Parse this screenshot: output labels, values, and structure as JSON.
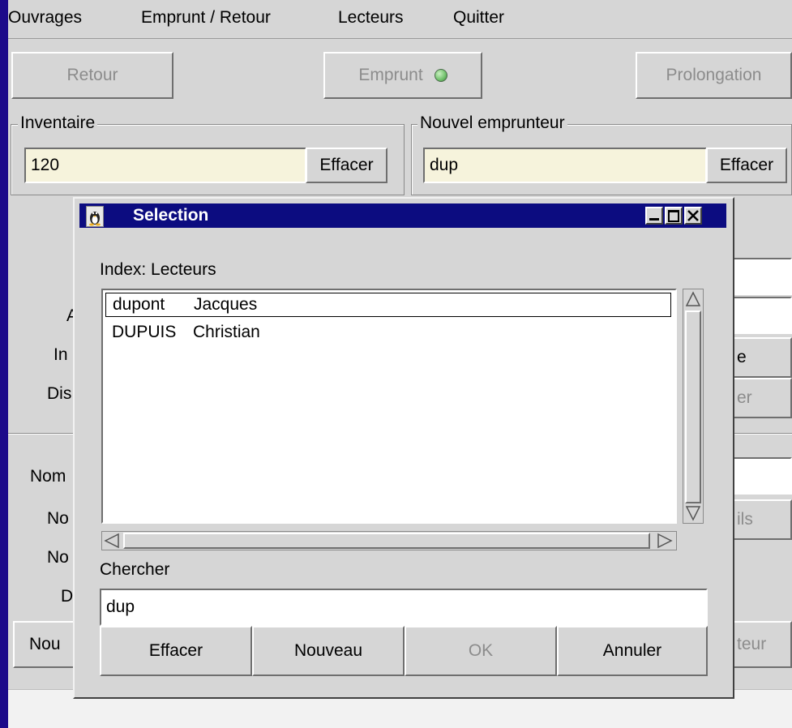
{
  "menu": [
    "Ouvrages",
    "Emprunt / Retour",
    "Lecteurs",
    "Quitter"
  ],
  "toolbar": {
    "retour": "Retour",
    "emprunt": "Emprunt",
    "prolongation": "Prolongation",
    "emprunt_indicator_color": "#6fc06a"
  },
  "inventaire": {
    "title": "Inventaire",
    "value": "120",
    "clear_label": "Effacer"
  },
  "emprunteur": {
    "title": "Nouvel emprunteur",
    "value": "dup",
    "clear_label": "Effacer"
  },
  "background_partial": {
    "label_in": "In",
    "label_dis": "Dis",
    "label_a": "A",
    "label_nom": "Nom",
    "label_no1": "No",
    "label_no2": "No",
    "label_d": "D",
    "btn_nou": "Nou",
    "right_e": "e",
    "right_er": "er",
    "right_ils": "ils",
    "right_teur": "teur"
  },
  "dialog": {
    "title": "Selection",
    "index_label": "Index: Lecteurs",
    "rows": [
      {
        "last": "dupont",
        "first": "Jacques",
        "selected": true
      },
      {
        "last": "DUPUIS",
        "first": "Christian",
        "selected": false
      }
    ],
    "search_label": "Chercher",
    "search_value": "dup",
    "buttons": {
      "effacer": "Effacer",
      "nouveau": "Nouveau",
      "ok": "OK",
      "annuler": "Annuler"
    }
  }
}
